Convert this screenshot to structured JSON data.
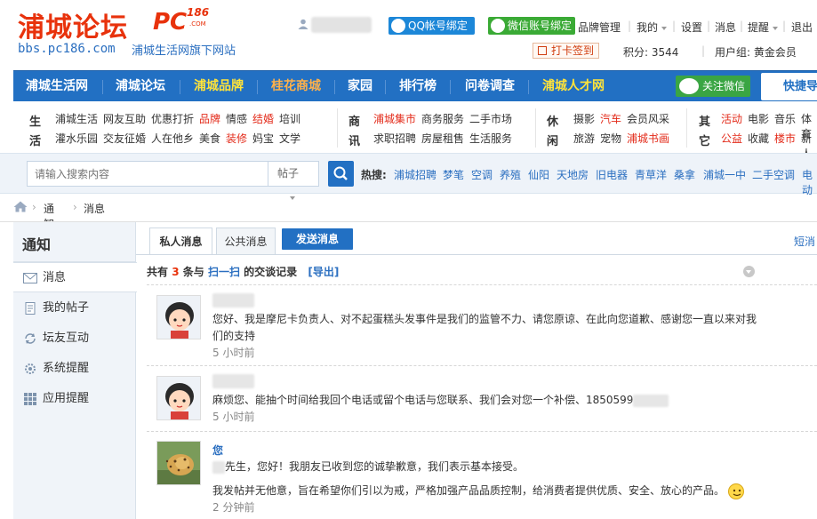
{
  "header": {
    "logo_cn": "浦城论坛",
    "logo_pc": "PC",
    "logo_186": "186",
    "logo_com": ".COM",
    "url": "bbs.pc186.com",
    "slogan": "浦城生活网旗下网站",
    "qq_bind": "QQ帐号绑定",
    "wx_bind": "微信账号绑定",
    "links": {
      "brand_manage": "品牌管理",
      "mine": "我的",
      "settings": "设置",
      "messages": "消息",
      "reminders": "提醒",
      "logout": "退出"
    },
    "checkin": "打卡签到",
    "points": "积分: 3544",
    "usergroup": "用户组: 黄金会员"
  },
  "nav": {
    "items": [
      {
        "label": "浦城生活网"
      },
      {
        "label": "浦城论坛"
      },
      {
        "label": "浦城品牌"
      },
      {
        "label": "桂花商城"
      },
      {
        "label": "家园"
      },
      {
        "label": "排行榜"
      },
      {
        "label": "问卷调查"
      },
      {
        "label": "浦城人才网"
      }
    ],
    "follow_wx": "关注微信",
    "quick_guide": "快捷导航"
  },
  "categories": {
    "life": {
      "head1": "生",
      "head2": "活",
      "row1": [
        "浦城生活",
        "网友互助",
        "优惠打折",
        "品牌",
        "情感",
        "结婚",
        "培训"
      ],
      "row2": [
        "灌水乐园",
        "交友征婚",
        "人在他乡",
        "美食",
        "装修",
        "妈宝",
        "文学"
      ]
    },
    "business": {
      "head1": "商",
      "head2": "讯",
      "row1": [
        "浦城集市",
        "商务服务",
        "二手市场"
      ],
      "row2": [
        "求职招聘",
        "房屋租售",
        "生活服务"
      ]
    },
    "leisure": {
      "head1": "休",
      "head2": "闲",
      "row1": [
        "摄影",
        "汽车",
        "会员风采"
      ],
      "row2": [
        "旅游",
        "宠物",
        "浦城书画"
      ]
    },
    "other": {
      "head1": "其",
      "head2": "它",
      "row1": [
        "活动",
        "电影",
        "音乐",
        "体育"
      ],
      "row2": [
        "公益",
        "收藏",
        "楼市",
        "新人"
      ]
    }
  },
  "search": {
    "placeholder": "请输入搜索内容",
    "type": "帖子",
    "hot_label": "热搜:",
    "hot": [
      "浦城招聘",
      "梦笔",
      "空调",
      "养殖",
      "仙阳",
      "天地房",
      "旧电器",
      "青草洋",
      "桑拿",
      "浦城一中",
      "二手空调",
      "电动"
    ]
  },
  "breadcrumb": {
    "items": [
      "通知",
      "消息"
    ]
  },
  "sidebar": {
    "title": "通知",
    "items": [
      {
        "label": "消息",
        "icon": "envelope-icon"
      },
      {
        "label": "我的帖子",
        "icon": "document-icon"
      },
      {
        "label": "坛友互动",
        "icon": "recycle-icon"
      },
      {
        "label": "系统提醒",
        "icon": "gear-icon"
      },
      {
        "label": "应用提醒",
        "icon": "grid-icon"
      }
    ]
  },
  "tabs": {
    "private": "私人消息",
    "public": "公共消息",
    "send": "发送消息",
    "short": "短消"
  },
  "conversation": {
    "prefix": "共有",
    "count": "3",
    "mid": "条与",
    "partner": "扫一扫",
    "suffix": "的交谈记录",
    "export": "[导出]"
  },
  "messages": [
    {
      "body": "您好、我是摩尼卡负责人、对不起蛋糕头发事件是我们的监管不力、请您原谅、在此向您道歉、感谢您一直以来对我们的支持",
      "time": "5 小时前"
    },
    {
      "body": "麻烦您、能抽个时间给我回个电话或留个电话与您联系、我们会对您一个补偿、1850599",
      "time": "5 小时前"
    },
    {
      "sender": "您",
      "line1": "先生，您好！我朋友已收到您的诚挚歉意，我们表示基本接受。",
      "line2": "我发帖并无他意，旨在希望你们引以为戒，严格加强产品品质控制，给消费者提供优质、安全、放心的产品。",
      "time": "2 分钟前"
    }
  ],
  "colors": {
    "brand_red": "#e8320c",
    "nav_blue": "#2270c3",
    "link_blue": "#2b6fc0",
    "wechat_green": "#3aaa35"
  }
}
